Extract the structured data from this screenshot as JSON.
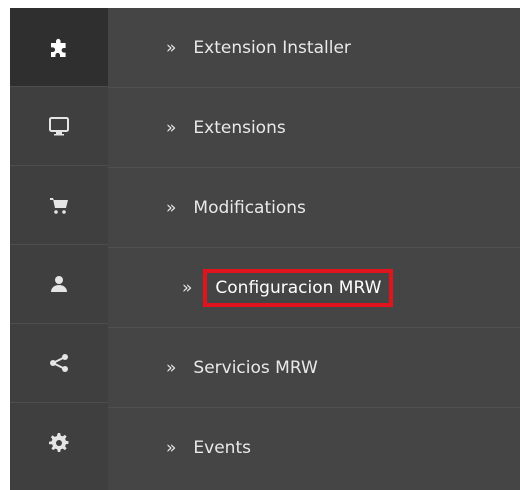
{
  "sidebar": {
    "icons": [
      {
        "name": "puzzle-icon"
      },
      {
        "name": "monitor-icon"
      },
      {
        "name": "cart-icon"
      },
      {
        "name": "user-icon"
      },
      {
        "name": "share-icon"
      },
      {
        "name": "gear-icon"
      }
    ]
  },
  "menu": {
    "items": [
      {
        "label": "Extension Installer"
      },
      {
        "label": "Extensions"
      },
      {
        "label": "Modifications"
      },
      {
        "label": "Configuracion MRW"
      },
      {
        "label": "Servicios MRW"
      },
      {
        "label": "Events"
      }
    ]
  },
  "colors": {
    "rail": "#3f3f3f",
    "panel": "#454545",
    "highlight": "#e0141c",
    "text": "#e9e9e9"
  }
}
